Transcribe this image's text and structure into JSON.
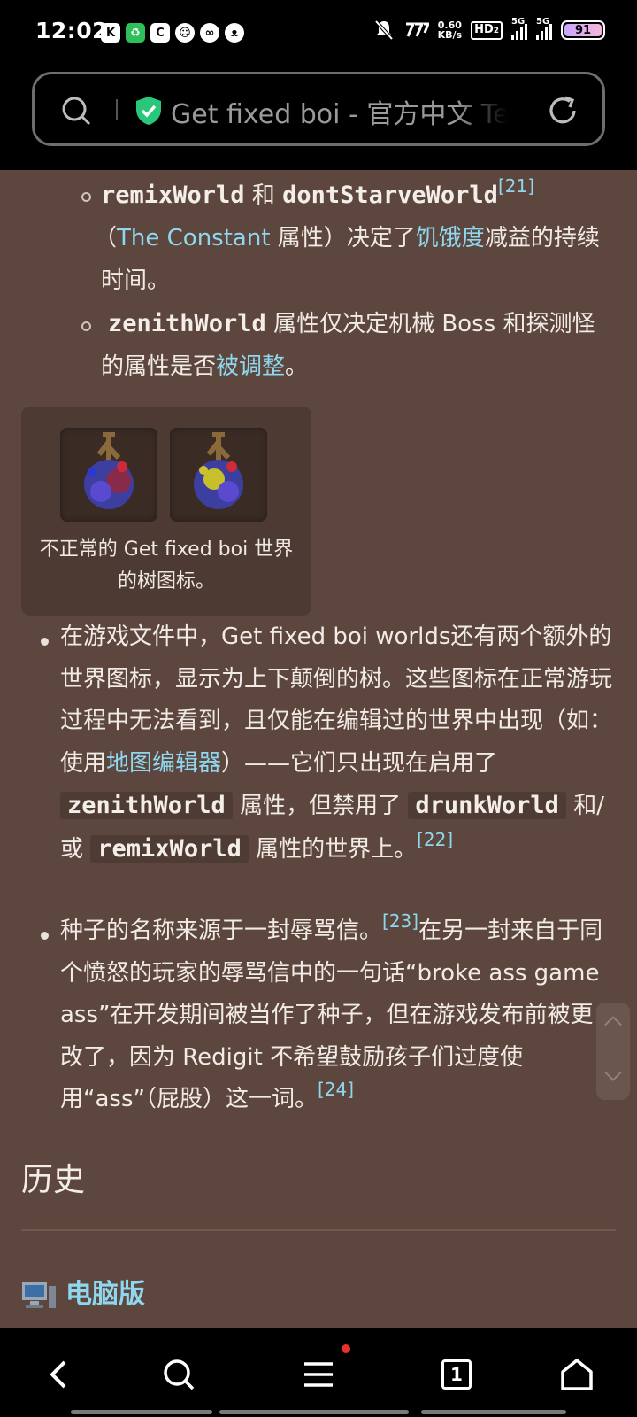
{
  "status": {
    "time": "12:02",
    "speed_value": "0.60",
    "speed_unit": "KB/s",
    "hd_label": "HD",
    "hd_index": "2",
    "sig1_label": "5G",
    "sig2_label": "5G",
    "battery": "91",
    "notification_icons": [
      "k-app-icon",
      "green-app-icon",
      "c-app-icon",
      "face-app-icon",
      "link-app-icon",
      "cat-app-icon"
    ]
  },
  "browser": {
    "url_text": "Get fixed boi - 官方中文 Terraria Wiki",
    "tab_count": "1"
  },
  "article": {
    "sub1": {
      "code1": "remixWorld",
      "conj": "和",
      "code2": "dontStarveWorld",
      "ref": "[21]",
      "p1": "（",
      "link1": "The Constant",
      "p2": " 属性）决定了",
      "link2": "饥饿度",
      "p3": "减益的持续时间。"
    },
    "sub2": {
      "code": "zenithWorld",
      "p1": "属性仅决定机械 Boss 和探测怪的属性是否",
      "link": "被调整",
      "p2": "。"
    },
    "gallery": {
      "caption": "不正常的 Get fixed boi 世界的树图标。"
    },
    "bullet1": {
      "p1": "在游戏文件中，Get fixed boi worlds还有两个额外的世界图标，显示为上下颠倒的树。这些图标在正常游玩过程中无法看到，且仅能在编辑过的世界中出现（如：使用",
      "link": "地图编辑器",
      "p2": "）——它们只出现在启用了",
      "code1": "zenithWorld",
      "p3": "属性，但禁用了",
      "code2": "drunkWorld",
      "p4": "和/或",
      "code3": "remixWorld",
      "p5": "属性的世界上。",
      "ref": "[22]"
    },
    "bullet2": {
      "p1": "种子的名称来源于一封辱骂信。",
      "ref1": "[23]",
      "p2": "在另一封来自于同个愤怒的玩家的辱骂信中的一句话“broke ass game ass”在开发期间被当作了种子，但在游戏发布前被更改了，因为 Redigit 不希望鼓励孩子们过度使用“ass”（屁股）这一词。",
      "ref2": "[24]"
    },
    "heading_history": "历史",
    "heading_pc": "电脑版"
  },
  "colors": {
    "background": "#5c463d",
    "link": "#8fd7ee",
    "panel": "#4d3a32"
  }
}
